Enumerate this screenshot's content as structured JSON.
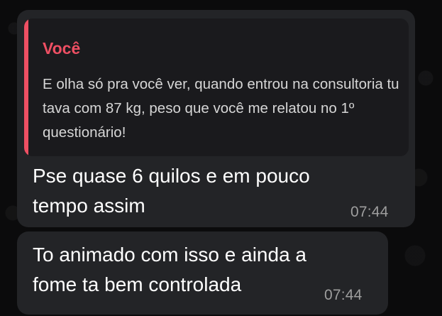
{
  "messages": [
    {
      "reply_to": {
        "author": "Você",
        "text": "E olha só pra você ver, quando entrou na consultoria tu tava com 87 kg, peso que você me relatou no 1º questionário!"
      },
      "text": "Pse quase 6 quilos e em pouco tempo assim",
      "time": "07:44"
    },
    {
      "text": "To animado com isso e ainda a fome ta bem controlada",
      "time": "07:44"
    }
  ],
  "colors": {
    "background": "#0b0b0c",
    "bubble": "#232427",
    "quoted_background": "#1a1a1d",
    "quote_accent": "#ee4f63",
    "message_text": "#ffffff",
    "quoted_text": "#d6d6d6",
    "timestamp": "#9e9e9e"
  }
}
